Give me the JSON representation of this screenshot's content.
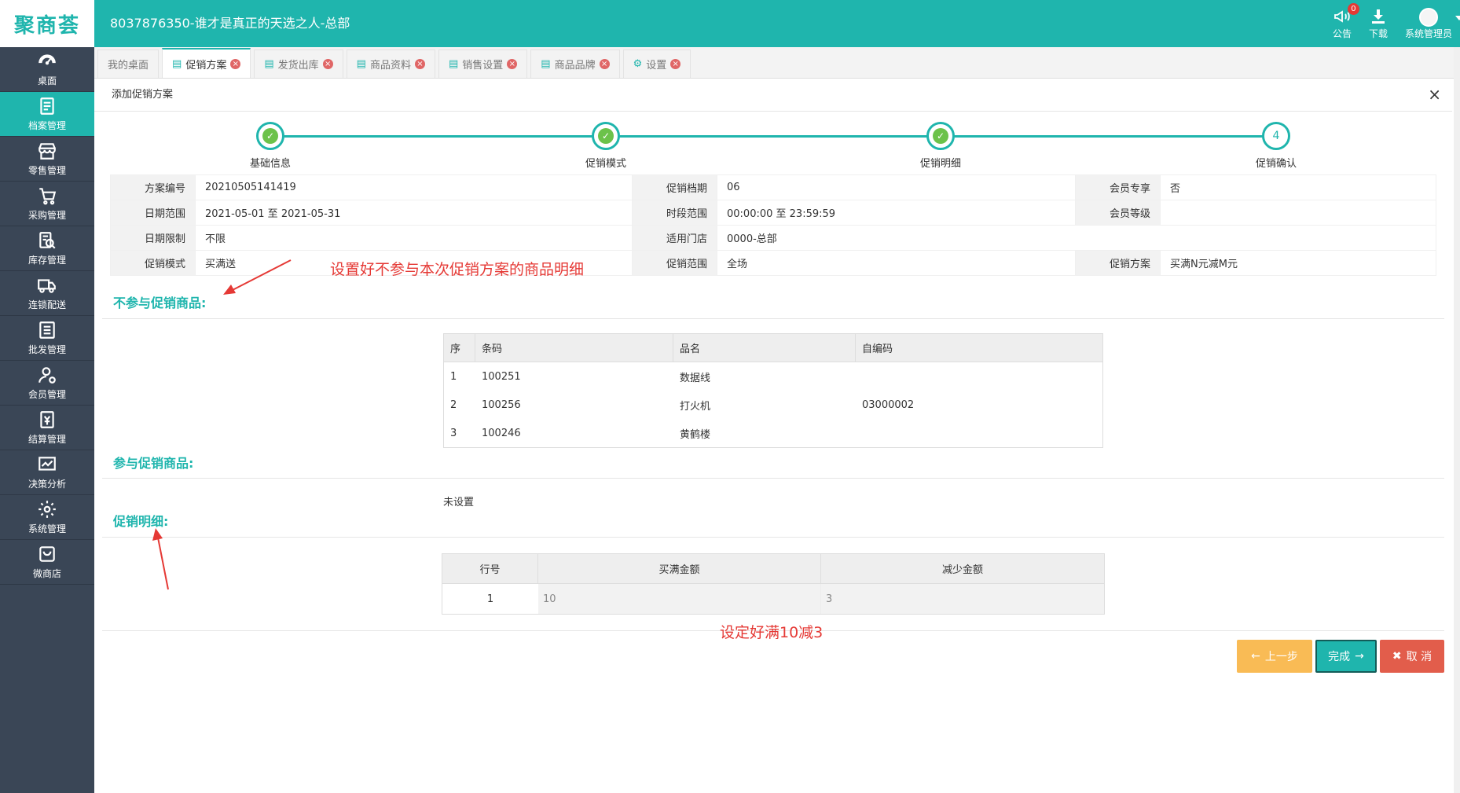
{
  "app": {
    "logo": "聚商荟",
    "title": "8037876350-谁才是真正的天选之人-总部"
  },
  "top_actions": [
    {
      "label": "公告",
      "icon": "megaphone-icon",
      "badge": "0"
    },
    {
      "label": "下载",
      "icon": "download-icon"
    },
    {
      "label": "系统管理员",
      "icon": "avatar"
    }
  ],
  "sidebar": {
    "items": [
      {
        "label": "桌面",
        "icon": "dashboard-icon"
      },
      {
        "label": "档案管理",
        "icon": "archive-icon",
        "active": true
      },
      {
        "label": "零售管理",
        "icon": "store-icon"
      },
      {
        "label": "采购管理",
        "icon": "cart-icon"
      },
      {
        "label": "库存管理",
        "icon": "inventory-icon"
      },
      {
        "label": "连锁配送",
        "icon": "truck-icon"
      },
      {
        "label": "批发管理",
        "icon": "wholesale-icon"
      },
      {
        "label": "会员管理",
        "icon": "member-icon"
      },
      {
        "label": "结算管理",
        "icon": "settlement-icon"
      },
      {
        "label": "决策分析",
        "icon": "chart-icon"
      },
      {
        "label": "系统管理",
        "icon": "gear-icon"
      },
      {
        "label": "微商店",
        "icon": "shop-bag-icon"
      }
    ]
  },
  "tabs": [
    {
      "label": "我的桌面",
      "closable": false
    },
    {
      "label": "促销方案",
      "closable": true,
      "active": true
    },
    {
      "label": "发货出库",
      "closable": true
    },
    {
      "label": "商品资料",
      "closable": true
    },
    {
      "label": "销售设置",
      "closable": true
    },
    {
      "label": "商品品牌",
      "closable": true
    },
    {
      "label": "设置",
      "closable": true
    }
  ],
  "dialog": {
    "title": "添加促销方案",
    "close": "×"
  },
  "steps": [
    {
      "label": "基础信息",
      "done": true
    },
    {
      "label": "促销模式",
      "done": true
    },
    {
      "label": "促销明细",
      "done": true
    },
    {
      "label": "促销确认",
      "number": "4",
      "done": false
    }
  ],
  "info": {
    "plan_no_label": "方案编号",
    "plan_no": "20210505141419",
    "period_label": "促销档期",
    "period": "06",
    "member_only_label": "会员专享",
    "member_only": "否",
    "date_range_label": "日期范围",
    "date_range": "2021-05-01 至 2021-05-31",
    "time_range_label": "时段范围",
    "time_range": "00:00:00 至 23:59:59",
    "member_level_label": "会员等级",
    "member_level": "",
    "date_limit_label": "日期限制",
    "date_limit": "不限",
    "stores_label": "适用门店",
    "stores": "0000-总部",
    "mode_label": "促销模式",
    "mode": "买满送",
    "scope_label": "促销范围",
    "scope": "全场",
    "scheme_label": "促销方案",
    "scheme": "买满N元减M元"
  },
  "annotations": {
    "excluded_note": "设置好不参与本次促销方案的商品明细",
    "detail_note": "设定好满10减3"
  },
  "excluded": {
    "title": "不参与促销商品:",
    "headers": [
      "序",
      "条码",
      "品名",
      "自编码"
    ],
    "rows": [
      [
        "1",
        "100251",
        "数据线",
        ""
      ],
      [
        "2",
        "100256",
        "打火机",
        "03000002"
      ],
      [
        "3",
        "100246",
        "黄鹤楼",
        ""
      ]
    ]
  },
  "included": {
    "title": "参与促销商品:",
    "empty_text": "未设置"
  },
  "detail": {
    "title": "促销明细:",
    "headers": [
      "行号",
      "买满金额",
      "减少金额"
    ],
    "rows": [
      [
        "1",
        "10",
        "3"
      ]
    ]
  },
  "buttons": {
    "prev": "上一步",
    "done": "完成",
    "cancel": "取 消"
  },
  "colors": {
    "brand": "#1fb5ad",
    "sidebar": "#3a4656",
    "annotation": "#e53935",
    "prev_button": "#f9bb55",
    "cancel_button": "#e25d4b"
  }
}
